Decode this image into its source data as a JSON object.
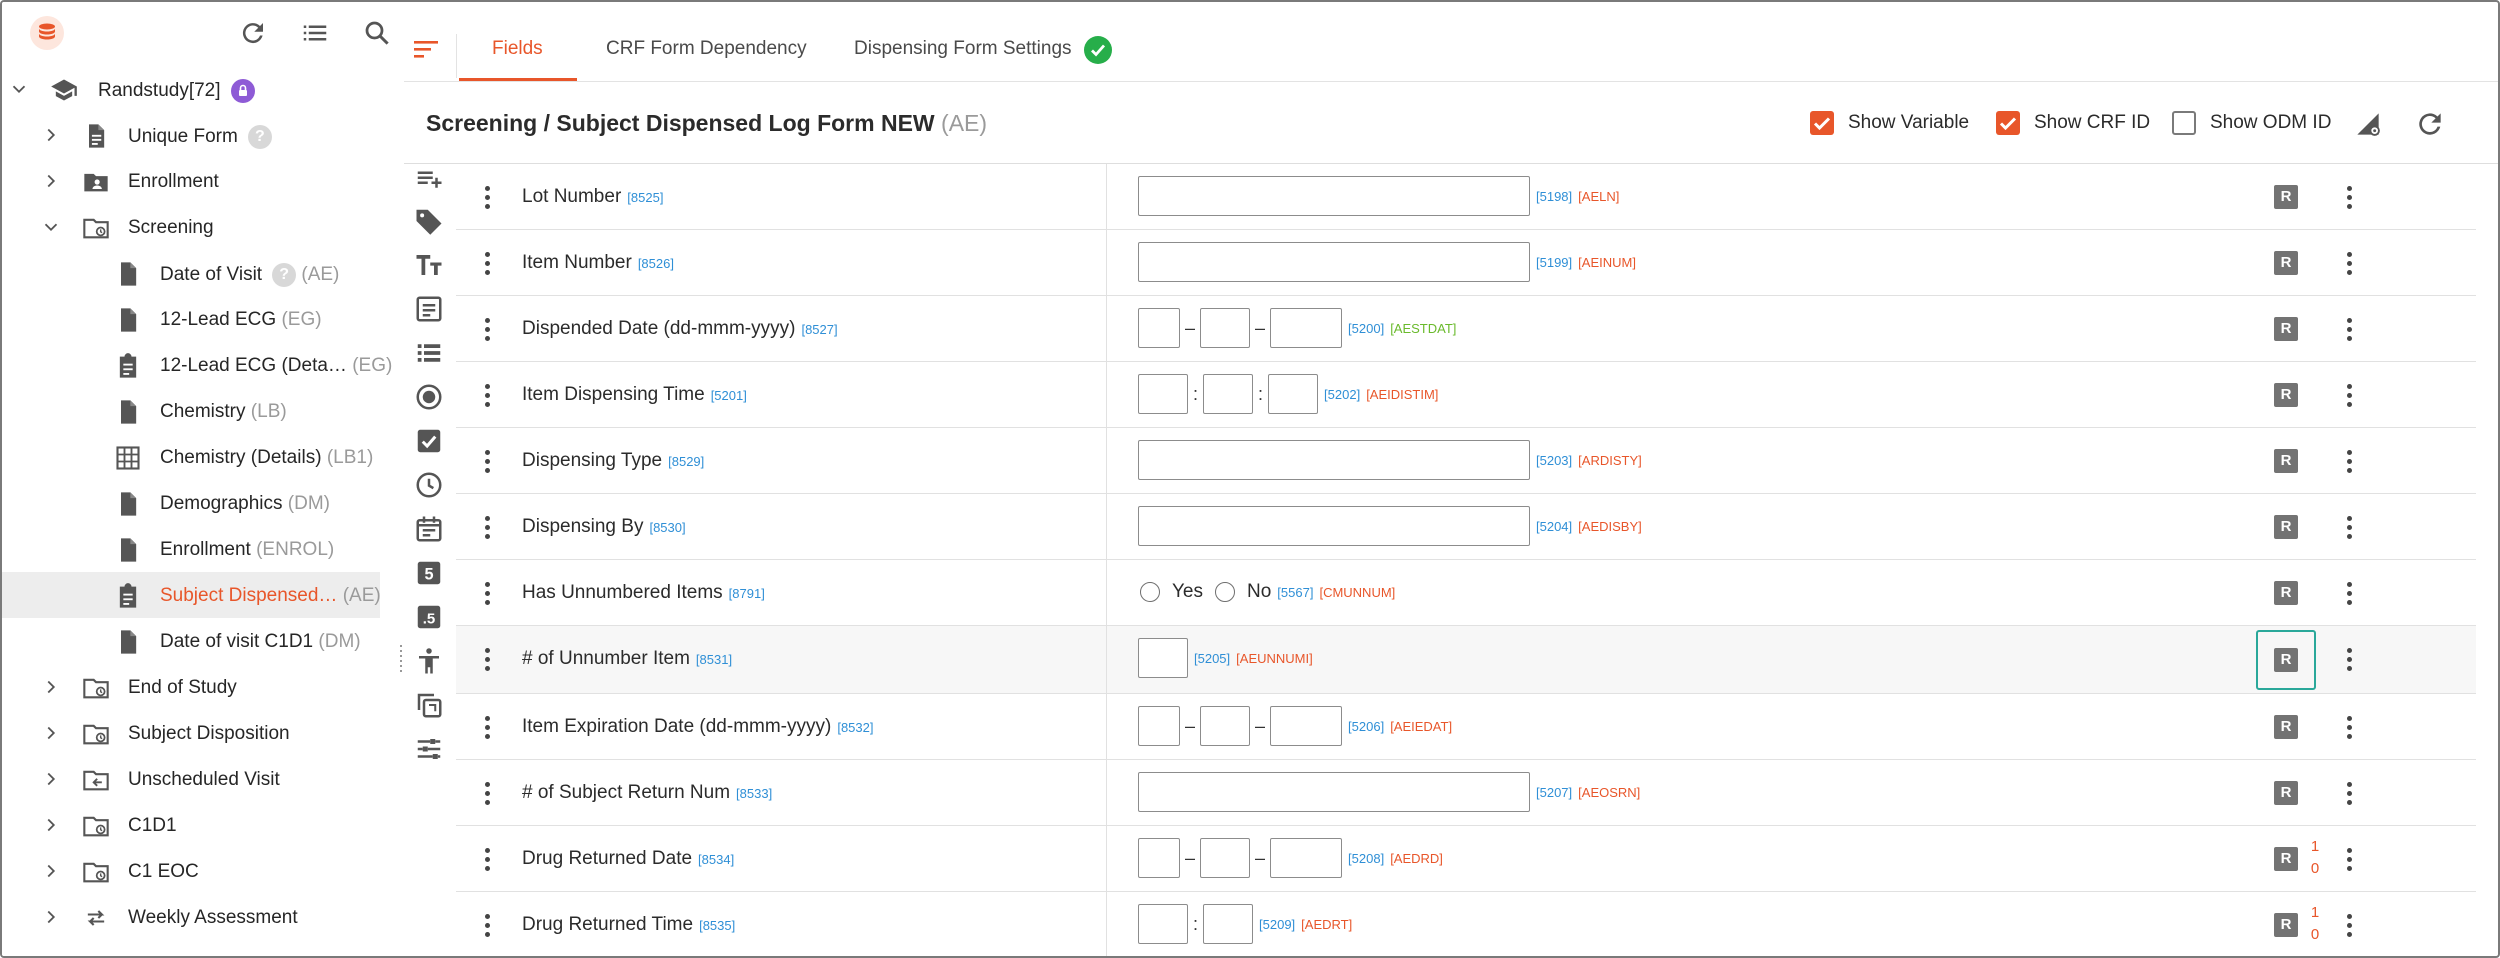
{
  "sidebar": {
    "study": {
      "label": "Randstudy[72]"
    },
    "items": [
      {
        "label": "Unique Form",
        "code": "",
        "type": "form",
        "help": "?"
      },
      {
        "label": "Enrollment",
        "code": "",
        "type": "visit"
      },
      {
        "label": "Screening",
        "code": "",
        "type": "visit",
        "expanded": true
      },
      {
        "label": "Date of Visit",
        "code": "(AE)",
        "type": "form",
        "help": "?"
      },
      {
        "label": "12-Lead ECG",
        "code": "(EG)",
        "type": "form"
      },
      {
        "label": "12-Lead ECG (Deta…",
        "code": "(EG)",
        "type": "log"
      },
      {
        "label": "Chemistry",
        "code": "(LB)",
        "type": "form"
      },
      {
        "label": "Chemistry (Details)",
        "code": "(LB1)",
        "type": "table"
      },
      {
        "label": "Demographics",
        "code": "(DM)",
        "type": "form"
      },
      {
        "label": "Enrollment",
        "code": "(ENROL)",
        "type": "form"
      },
      {
        "label": "Subject Dispensed…",
        "code": "(AE)",
        "type": "log",
        "selected": true
      },
      {
        "label": "Date of visit C1D1",
        "code": "(DM)",
        "type": "form"
      },
      {
        "label": "End of Study",
        "code": "",
        "type": "visit"
      },
      {
        "label": "Subject Disposition",
        "code": "",
        "type": "visit"
      },
      {
        "label": "Unscheduled Visit",
        "code": "",
        "type": "unscheduled"
      },
      {
        "label": "C1D1",
        "code": "",
        "type": "visit"
      },
      {
        "label": "C1 EOC",
        "code": "",
        "type": "visit"
      },
      {
        "label": "Weekly Assessment",
        "code": "",
        "type": "repeat"
      }
    ]
  },
  "tabs": [
    {
      "label": "Fields",
      "active": true
    },
    {
      "label": "CRF Form Dependency",
      "active": false
    },
    {
      "label": "Dispensing Form Settings",
      "active": false,
      "status": "check-circle-icon"
    }
  ],
  "form": {
    "title": "Screening / Subject Dispensed Log Form NEW",
    "code": "(AE)",
    "options": [
      {
        "label": "Show Variable",
        "checked": true
      },
      {
        "label": "Show CRF ID",
        "checked": true
      },
      {
        "label": "Show ODM ID",
        "checked": false
      }
    ]
  },
  "fields": [
    {
      "label": "Lot Number",
      "id": "[8525]",
      "control": "text",
      "crf_id": "[5198]",
      "var": "[AELN]",
      "required": "R"
    },
    {
      "label": "Item Number",
      "id": "[8526]",
      "control": "text",
      "crf_id": "[5199]",
      "var": "[AEINUM]",
      "required": "R"
    },
    {
      "label": "Dispended Date (dd-mmm-yyyy)",
      "id": "[8527]",
      "control": "date",
      "crf_id": "[5200]",
      "var": "[AESTDAT]",
      "var_color": "green",
      "required": "R"
    },
    {
      "label": "Item Dispensing Time",
      "id": "[5201]",
      "control": "time3",
      "crf_id": "[5202]",
      "var": "[AEIDISTIM]",
      "required": "R"
    },
    {
      "label": "Dispensing Type",
      "id": "[8529]",
      "control": "text",
      "crf_id": "[5203]",
      "var": "[ARDISTY]",
      "required": "R"
    },
    {
      "label": "Dispensing By",
      "id": "[8530]",
      "control": "text",
      "crf_id": "[5204]",
      "var": "[AEDISBY]",
      "required": "R"
    },
    {
      "label": "Has Unnumbered Items",
      "id": "[8791]",
      "control": "radio",
      "options": [
        "Yes",
        "No"
      ],
      "crf_id": "[5567]",
      "var": "[CMUNNUM]",
      "required": "R"
    },
    {
      "label": "# of Unnumber Item",
      "id": "[8531]",
      "control": "number",
      "crf_id": "[5205]",
      "var": "[AEUNNUMI]",
      "required": "R",
      "highlighted": true
    },
    {
      "label": "Item Expiration Date (dd-mmm-yyyy)",
      "id": "[8532]",
      "control": "date",
      "crf_id": "[5206]",
      "var": "[AEIEDAT]",
      "required": "R"
    },
    {
      "label": "# of Subject Return Num",
      "id": "[8533]",
      "control": "text",
      "crf_id": "[5207]",
      "var": "[AEOSRN]",
      "required": "R"
    },
    {
      "label": "Drug Returned Date",
      "id": "[8534]",
      "control": "date",
      "crf_id": "[5208]",
      "var": "[AEDRD]",
      "required": "R",
      "stack": [
        "1",
        "0"
      ]
    },
    {
      "label": "Drug Returned Time",
      "id": "[8535]",
      "control": "time2",
      "crf_id": "[5209]",
      "var": "[AEDRT]",
      "required": "R",
      "stack": [
        "1",
        "0"
      ]
    }
  ],
  "icons": {
    "toolbar": [
      "refresh-icon",
      "list-icon",
      "search-icon"
    ],
    "palette": [
      "add-field-icon",
      "tag-icon",
      "text-size-icon",
      "text-area-icon",
      "list-icon",
      "radio-icon",
      "checkbox-icon",
      "clock-icon",
      "calendar-icon",
      "number-icon",
      "decimal-icon",
      "accessibility-icon",
      "copy-icon",
      "sliders-icon"
    ]
  },
  "colors": {
    "accent": "#e8562a",
    "link": "#2f8fd6",
    "success": "#27ae4a",
    "focus": "#2aa89a",
    "badge": "#8e5bd6"
  }
}
